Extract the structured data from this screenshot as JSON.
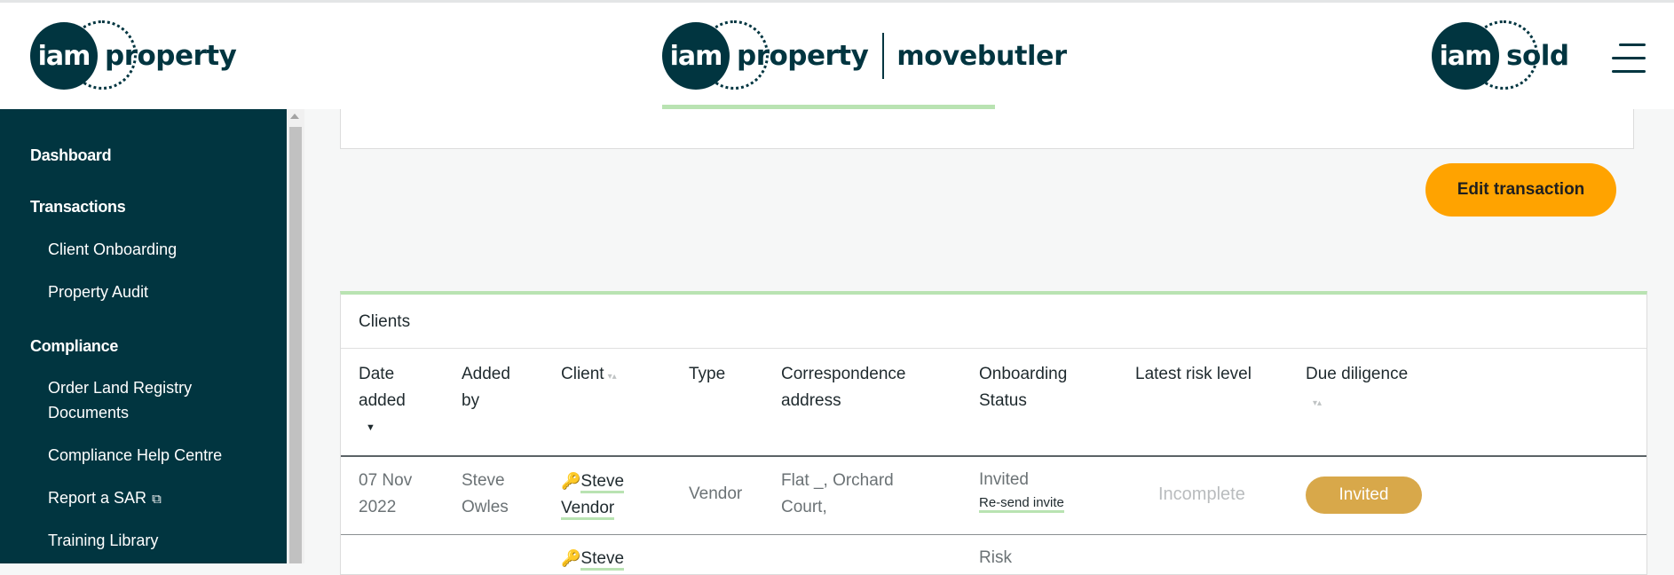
{
  "header": {
    "left_logo": {
      "circle_text": "iam",
      "word": "property"
    },
    "center_logo": {
      "circle_text": "iam",
      "word": "property",
      "brand": "movebutler"
    },
    "right_logo": {
      "circle_text": "iam",
      "word": "sold"
    },
    "menu_icon": "hamburger-icon"
  },
  "sidebar": {
    "items": [
      {
        "label": "Dashboard"
      },
      {
        "label": "Transactions"
      },
      {
        "label": "Client Onboarding"
      },
      {
        "label": "Property Audit"
      },
      {
        "label": "Compliance"
      },
      {
        "label": "Order Land Registry Documents"
      },
      {
        "label": "Compliance Help Centre"
      },
      {
        "label": "Report a SAR",
        "icon": "external-link-icon"
      },
      {
        "label": "Training Library"
      }
    ]
  },
  "actions": {
    "edit_label": "Edit transaction"
  },
  "clients": {
    "title": "Clients",
    "columns": [
      "Date added",
      "Added by",
      "Client",
      "Type",
      "Correspondence address",
      "Onboarding Status",
      "Latest risk level",
      "Due diligence"
    ],
    "rows": [
      {
        "date": "07 Nov 2022",
        "added_by": "Steve Owles",
        "client": "Steve Vendor",
        "type": "Vendor",
        "address": "Flat _, Orchard Court,",
        "status": "Invited",
        "status_action": "Re-send invite",
        "risk": "Incomplete",
        "due_diligence": "Invited"
      },
      {
        "client": "Steve",
        "status": "Risk"
      }
    ]
  },
  "colors": {
    "brand_dark": "#013540",
    "accent_green": "#b9e3b2",
    "button_orange": "#ffa300",
    "pill_gold": "#d8a84a"
  }
}
